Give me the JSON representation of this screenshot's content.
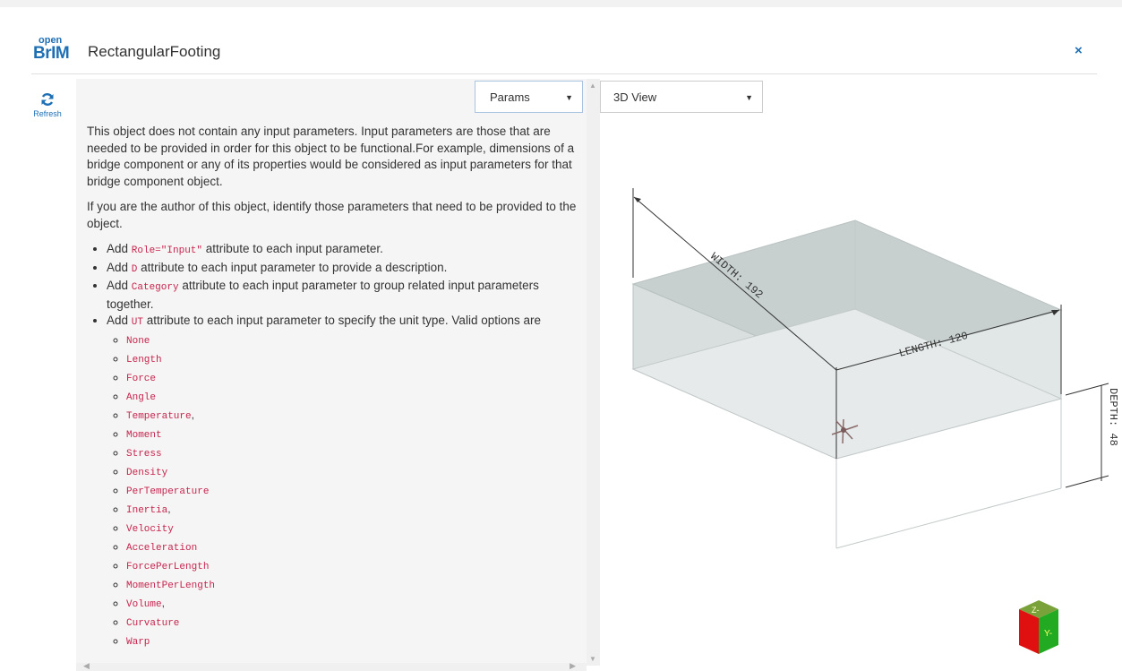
{
  "app": {
    "logo_top": "open",
    "logo_bottom": "BrIM",
    "title": "RectangularFooting",
    "close_label": "×"
  },
  "toolbar": {
    "refresh_label": "Refresh"
  },
  "selects": {
    "left_panel": "Params",
    "right_panel": "3D View"
  },
  "content": {
    "intro": "This object does not contain any input parameters. Input parameters are those that are needed to be provided in order for this object to be functional.For example, dimensions of a bridge component or any of its properties would be considered as input parameters for that bridge component object.",
    "author_note": "If you are the author of this object, identify those parameters that need to be provided to the object.",
    "items": [
      {
        "pre": "Add ",
        "code": "Role=\"Input\"",
        "post": " attribute to each input parameter."
      },
      {
        "pre": "Add ",
        "code": "D",
        "post": " attribute to each input parameter to provide a description."
      },
      {
        "pre": "Add ",
        "code": "Category",
        "post": " attribute to each input parameter to group related input parameters together."
      },
      {
        "pre": "Add ",
        "code": "UT",
        "post": " attribute to each input parameter to specify the unit type. Valid options are"
      }
    ],
    "unit_types": [
      {
        "code": "None",
        "suffix": ""
      },
      {
        "code": "Length",
        "suffix": ""
      },
      {
        "code": "Force",
        "suffix": ""
      },
      {
        "code": "Angle",
        "suffix": ""
      },
      {
        "code": "Temperature",
        "suffix": ","
      },
      {
        "code": "Moment",
        "suffix": ""
      },
      {
        "code": "Stress",
        "suffix": ""
      },
      {
        "code": "Density",
        "suffix": ""
      },
      {
        "code": "PerTemperature",
        "suffix": ""
      },
      {
        "code": "Inertia",
        "suffix": ","
      },
      {
        "code": "Velocity",
        "suffix": ""
      },
      {
        "code": "Acceleration",
        "suffix": ""
      },
      {
        "code": "ForcePerLength",
        "suffix": ""
      },
      {
        "code": "MomentPerLength",
        "suffix": ""
      },
      {
        "code": "Volume",
        "suffix": ","
      },
      {
        "code": "Curvature",
        "suffix": ""
      },
      {
        "code": "Warp",
        "suffix": ""
      }
    ]
  },
  "viewer": {
    "width_label": "WIDTH: 192",
    "length_label": "LENGTH: 120",
    "depth_label": "DEPTH: 48",
    "cube_z": "Z-",
    "cube_y": "Y-"
  },
  "colors": {
    "accent": "#1f6fb5",
    "code": "#c7254e",
    "box_fill": "#c9d0d0"
  }
}
